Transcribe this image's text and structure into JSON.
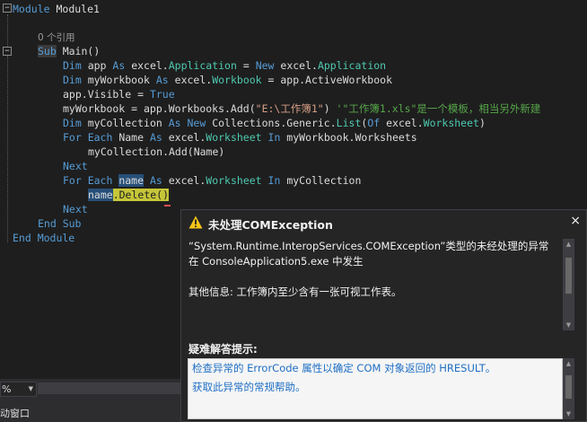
{
  "editor": {
    "collapse_open": "−",
    "lines": [
      {
        "name": "line-module",
        "tokens": [
          [
            "keyword",
            "Module "
          ],
          [
            "plain",
            "Module1"
          ]
        ]
      },
      {
        "name": "line-blank-1",
        "tokens": []
      },
      {
        "name": "line-references",
        "tokens": [
          [
            "ref",
            "0 个引用"
          ]
        ]
      },
      {
        "name": "line-sub-main",
        "tokens": [
          [
            "sub",
            "Sub"
          ],
          [
            "plain",
            " Main()"
          ]
        ]
      },
      {
        "name": "line-dim-app",
        "tokens": [
          [
            "keyword",
            "Dim "
          ],
          [
            "plain",
            "app "
          ],
          [
            "keyword",
            "As "
          ],
          [
            "plain",
            "excel."
          ],
          [
            "type",
            "Application"
          ],
          [
            "plain",
            " = "
          ],
          [
            "keyword",
            "New "
          ],
          [
            "plain",
            "excel."
          ],
          [
            "type",
            "Application"
          ]
        ]
      },
      {
        "name": "line-dim-workbook",
        "tokens": [
          [
            "keyword",
            "Dim "
          ],
          [
            "plain",
            "myWorkbook "
          ],
          [
            "keyword",
            "As "
          ],
          [
            "plain",
            "excel."
          ],
          [
            "type",
            "Workbook"
          ],
          [
            "plain",
            " = app.ActiveWorkbook"
          ]
        ]
      },
      {
        "name": "line-visible",
        "tokens": [
          [
            "plain",
            "app.Visible = "
          ],
          [
            "keyword",
            "True"
          ]
        ]
      },
      {
        "name": "line-workbooks-add",
        "tokens": [
          [
            "plain",
            "myWorkbook = app.Workbooks.Add("
          ],
          [
            "string",
            "\"E:\\工作簿1\""
          ],
          [
            "plain",
            ") "
          ],
          [
            "comment",
            "'\"工作簿1.xls\"是一个模板，相当另外新建"
          ]
        ]
      },
      {
        "name": "line-dim-collection",
        "tokens": [
          [
            "keyword",
            "Dim "
          ],
          [
            "plain",
            "myCollection "
          ],
          [
            "keyword",
            "As New "
          ],
          [
            "plain",
            "Collections.Generic."
          ],
          [
            "type",
            "List"
          ],
          [
            "plain",
            "("
          ],
          [
            "keyword",
            "Of "
          ],
          [
            "plain",
            "excel."
          ],
          [
            "type",
            "Worksheet"
          ],
          [
            "plain",
            ")"
          ]
        ]
      },
      {
        "name": "line-for-each-1",
        "tokens": [
          [
            "keyword",
            "For Each "
          ],
          [
            "plain",
            "Name "
          ],
          [
            "keyword",
            "As "
          ],
          [
            "plain",
            "excel."
          ],
          [
            "type",
            "Worksheet"
          ],
          [
            "plain",
            " "
          ],
          [
            "keyword",
            "In "
          ],
          [
            "plain",
            "myWorkbook.Worksheets"
          ]
        ]
      },
      {
        "name": "line-collection-add",
        "tokens": [
          [
            "plain",
            "myCollection.Add(Name)"
          ]
        ]
      },
      {
        "name": "line-next-1",
        "tokens": [
          [
            "keyword",
            "Next"
          ]
        ]
      },
      {
        "name": "line-for-each-2",
        "tokens": [
          [
            "keyword",
            "For Each "
          ],
          [
            "word",
            "name"
          ],
          [
            "plain",
            " "
          ],
          [
            "keyword",
            "As "
          ],
          [
            "plain",
            "excel."
          ],
          [
            "type",
            "Worksheet"
          ],
          [
            "plain",
            " "
          ],
          [
            "keyword",
            "In "
          ],
          [
            "plain",
            "myCollection"
          ]
        ]
      },
      {
        "name": "line-delete",
        "tokens": [
          [
            "current-name",
            "name"
          ],
          [
            "current",
            ".Delete()"
          ]
        ]
      },
      {
        "name": "line-next-2",
        "tokens": [
          [
            "keyword",
            "Next"
          ]
        ]
      },
      {
        "name": "line-end-sub",
        "tokens": [
          [
            "keyword",
            "End Sub"
          ]
        ]
      },
      {
        "name": "line-end-module",
        "tokens": [
          [
            "keyword",
            "End Module"
          ]
        ]
      }
    ]
  },
  "statusbar": {
    "zoom_value": "%",
    "bottom_tab": "动窗口"
  },
  "exception": {
    "title": "未处理COMException",
    "close": "×",
    "message": "“System.Runtime.InteropServices.COMException”类型的未经处理的异常在 ConsoleApplication5.exe 中发生",
    "info": "其他信息: 工作簿内至少含有一张可视工作表。",
    "tips_title": "疑难解答提示:",
    "tips": [
      "检查异常的 ErrorCode 属性以确定 COM 对象返回的 HRESULT。",
      "获取此异常的常规帮助。"
    ]
  },
  "colors": {
    "background": "#1e1e1e",
    "keyword": "#569cd6",
    "type": "#4ec9b0",
    "string": "#d69d85",
    "comment": "#57a64a",
    "current_statement": "#c6c639",
    "link": "#1f6fc5",
    "warning": "#f5c518"
  },
  "icons": {
    "warning": "warning-icon",
    "close": "close-icon",
    "collapse": "collapse-icon"
  }
}
